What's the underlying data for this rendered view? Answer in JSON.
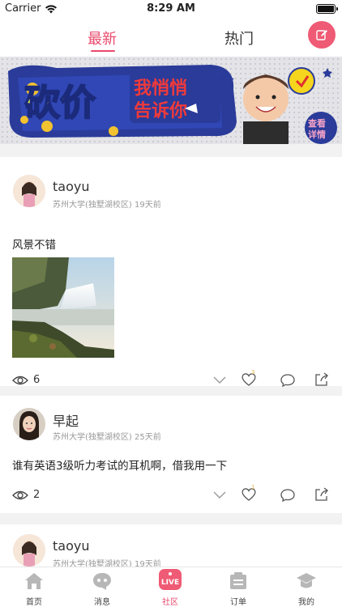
{
  "status_bar": {
    "carrier": "Carrier",
    "time": "8:29 AM"
  },
  "header": {
    "tabs": [
      {
        "label": "最新",
        "active": true
      },
      {
        "label": "热门",
        "active": false
      }
    ],
    "compose_icon": "edit-icon"
  },
  "banner": {
    "text_left": "砍价",
    "text_mid": "我悄悄告诉你",
    "text_stamp": "查看详情"
  },
  "posts": [
    {
      "username": "taoyu",
      "school": "苏州大学(独墅湖校区)",
      "time_ago": "19天前",
      "content": "风景不错",
      "has_image": true,
      "views": "6",
      "likes": "3"
    },
    {
      "username": "早起",
      "school": "苏州大学(独墅湖校区)",
      "time_ago": "25天前",
      "content": "谁有英语3级听力考试的耳机啊，借我用一下",
      "has_image": false,
      "views": "2",
      "likes": "1"
    },
    {
      "username": "taoyu",
      "school": "苏州大学(独墅湖校区)",
      "time_ago": "19天前"
    }
  ],
  "tabbar": [
    {
      "label": "首页",
      "icon": "home-icon"
    },
    {
      "label": "消息",
      "icon": "message-icon"
    },
    {
      "label": "社区",
      "icon": "live-icon",
      "active": true
    },
    {
      "label": "订单",
      "icon": "order-icon"
    },
    {
      "label": "我的",
      "icon": "profile-icon"
    }
  ],
  "colors": {
    "accent": "#e94a6c",
    "compose": "#ef5a74",
    "banner_blue": "#2a3b9a"
  }
}
